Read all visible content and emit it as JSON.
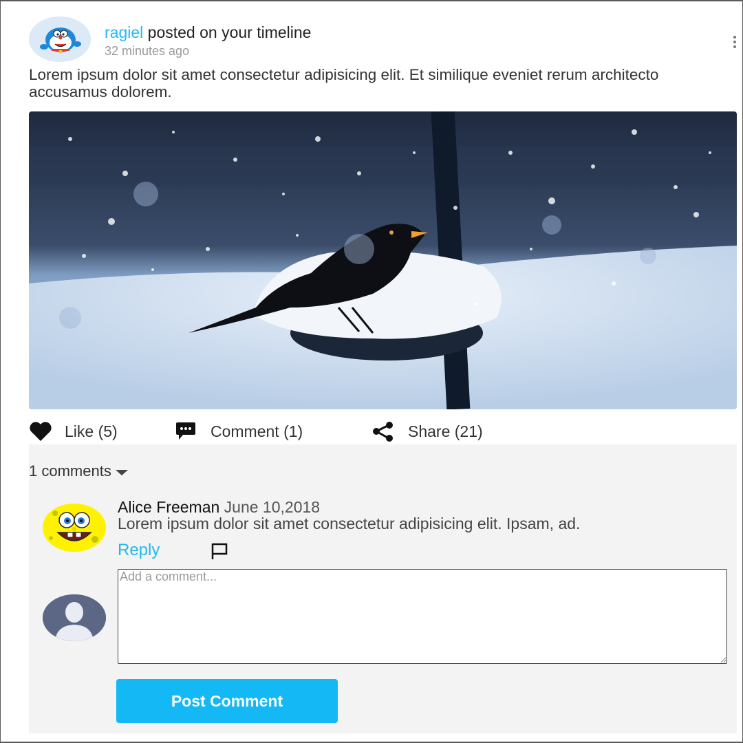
{
  "post": {
    "author": "ragiel",
    "headline_suffix": " posted on your timeline",
    "time": "32 minutes ago",
    "text": "Lorem ipsum dolor sit amet consectetur adipisicing elit. Et similique eveniet rerum architecto accusamus dolorem.",
    "image_icon": "blackbird-in-snow-photo",
    "author_avatar_icon": "doraemon-avatar"
  },
  "actions": {
    "like_label": "Like (5)",
    "comment_label": "Comment (1)",
    "share_label": "Share (21)"
  },
  "comments": {
    "toggle_label": "1 comments",
    "items": [
      {
        "author": "Alice Freeman",
        "date": "June 10,2018",
        "text": "Lorem ipsum dolor sit amet consectetur adipisicing elit. Ipsam, ad.",
        "reply_label": "Reply",
        "avatar_icon": "spongebob-avatar"
      }
    ],
    "input_placeholder": "Add a comment...",
    "input_value": "",
    "submit_label": "Post Comment"
  },
  "colors": {
    "accent": "#22b9f0",
    "button": "#14b8f5",
    "panel_bg": "#f3f3f3",
    "user_avatar_bg": "#5b6785"
  }
}
